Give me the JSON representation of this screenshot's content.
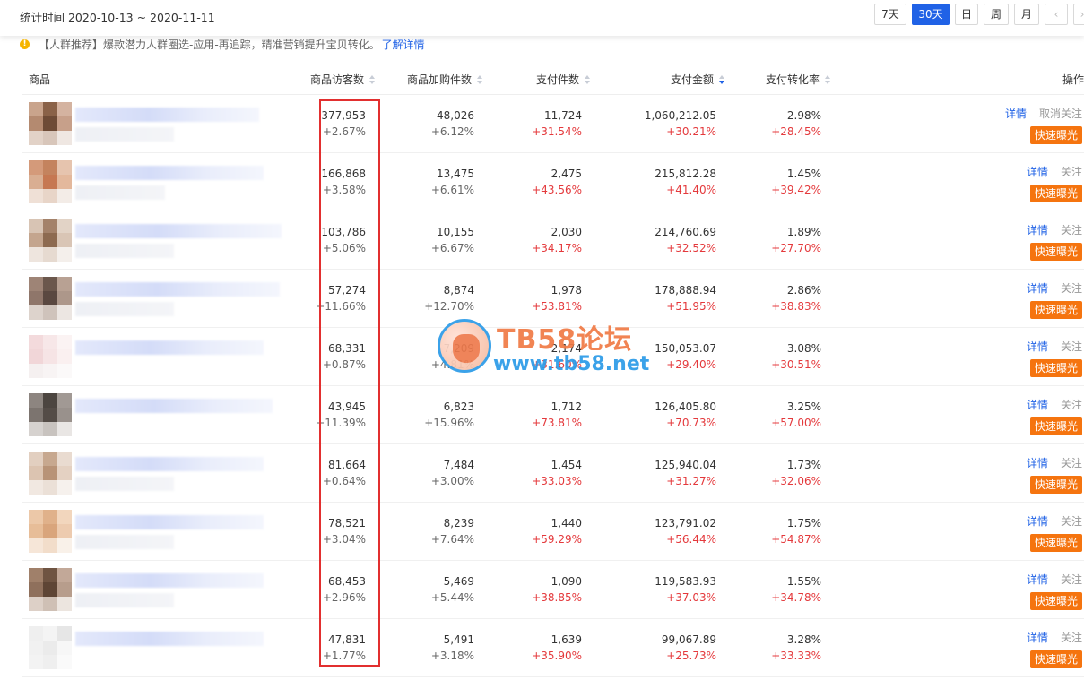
{
  "header": {
    "stat_range": "统计时间 2020-10-13 ~ 2020-11-11",
    "range_buttons": [
      "7天",
      "30天",
      "日",
      "周",
      "月"
    ],
    "active_range": "30天",
    "prev_label": "‹",
    "next_label": "›"
  },
  "notice": {
    "text": "【人群推荐】爆款潜力人群圈选-应用-再追踪，精准营销提升宝贝转化。",
    "link": "了解详情"
  },
  "table": {
    "columns": {
      "product": "商品",
      "visitors": "商品访客数",
      "cart": "商品加购件数",
      "paid_items": "支付件数",
      "paid_amount": "支付金额",
      "conversion": "支付转化率",
      "ops": "操作"
    },
    "labels": {
      "detail": "详情",
      "follow": "关注",
      "unfollow": "取消关注",
      "boost": "快速曝光"
    },
    "rows": [
      {
        "visitors": "377,953",
        "visitors_chg": "+2.67%",
        "cart": "48,026",
        "cart_chg": "+6.12%",
        "paid_items": "11,724",
        "paid_items_chg": "+31.54%",
        "paid_amount": "1,060,212.05",
        "paid_amount_chg": "+30.21%",
        "conversion": "2.98%",
        "conversion_chg": "+28.45%",
        "follow_label": "取消关注"
      },
      {
        "visitors": "166,868",
        "visitors_chg": "+3.58%",
        "cart": "13,475",
        "cart_chg": "+6.61%",
        "paid_items": "2,475",
        "paid_items_chg": "+43.56%",
        "paid_amount": "215,812.28",
        "paid_amount_chg": "+41.40%",
        "conversion": "1.45%",
        "conversion_chg": "+39.42%",
        "follow_label": "关注"
      },
      {
        "visitors": "103,786",
        "visitors_chg": "+5.06%",
        "cart": "10,155",
        "cart_chg": "+6.67%",
        "paid_items": "2,030",
        "paid_items_chg": "+34.17%",
        "paid_amount": "214,760.69",
        "paid_amount_chg": "+32.52%",
        "conversion": "1.89%",
        "conversion_chg": "+27.70%",
        "follow_label": "关注"
      },
      {
        "visitors": "57,274",
        "visitors_chg": "+11.66%",
        "cart": "8,874",
        "cart_chg": "+12.70%",
        "paid_items": "1,978",
        "paid_items_chg": "+53.81%",
        "paid_amount": "178,888.94",
        "paid_amount_chg": "+51.95%",
        "conversion": "2.86%",
        "conversion_chg": "+38.83%",
        "follow_label": "关注"
      },
      {
        "visitors": "68,331",
        "visitors_chg": "+0.87%",
        "cart": "7,209",
        "cart_chg": "+4.81%",
        "paid_items": "2,174",
        "paid_items_chg": "+31.60%",
        "paid_amount": "150,053.07",
        "paid_amount_chg": "+29.40%",
        "conversion": "3.08%",
        "conversion_chg": "+30.51%",
        "follow_label": "关注"
      },
      {
        "visitors": "43,945",
        "visitors_chg": "+11.39%",
        "cart": "6,823",
        "cart_chg": "+15.96%",
        "paid_items": "1,712",
        "paid_items_chg": "+73.81%",
        "paid_amount": "126,405.80",
        "paid_amount_chg": "+70.73%",
        "conversion": "3.25%",
        "conversion_chg": "+57.00%",
        "follow_label": "关注"
      },
      {
        "visitors": "81,664",
        "visitors_chg": "+0.64%",
        "cart": "7,484",
        "cart_chg": "+3.00%",
        "paid_items": "1,454",
        "paid_items_chg": "+33.03%",
        "paid_amount": "125,940.04",
        "paid_amount_chg": "+31.27%",
        "conversion": "1.73%",
        "conversion_chg": "+32.06%",
        "follow_label": "关注"
      },
      {
        "visitors": "78,521",
        "visitors_chg": "+3.04%",
        "cart": "8,239",
        "cart_chg": "+7.64%",
        "paid_items": "1,440",
        "paid_items_chg": "+59.29%",
        "paid_amount": "123,791.02",
        "paid_amount_chg": "+56.44%",
        "conversion": "1.75%",
        "conversion_chg": "+54.87%",
        "follow_label": "关注"
      },
      {
        "visitors": "68,453",
        "visitors_chg": "+2.96%",
        "cart": "5,469",
        "cart_chg": "+5.44%",
        "paid_items": "1,090",
        "paid_items_chg": "+38.85%",
        "paid_amount": "119,583.93",
        "paid_amount_chg": "+37.03%",
        "conversion": "1.55%",
        "conversion_chg": "+34.78%",
        "follow_label": "关注"
      },
      {
        "visitors": "47,831",
        "visitors_chg": "+1.77%",
        "cart": "5,491",
        "cart_chg": "+3.18%",
        "paid_items": "1,639",
        "paid_items_chg": "+35.90%",
        "paid_amount": "99,067.89",
        "paid_amount_chg": "+25.73%",
        "conversion": "3.28%",
        "conversion_chg": "+33.33%",
        "follow_label": "关注"
      }
    ]
  },
  "watermark": {
    "title": "TB58论坛",
    "url": "www.tb58.net"
  },
  "colors": {
    "accent": "#2062e6",
    "increase": "#e4393c",
    "boost": "#f5740f",
    "highlight": "#e22f2f"
  }
}
